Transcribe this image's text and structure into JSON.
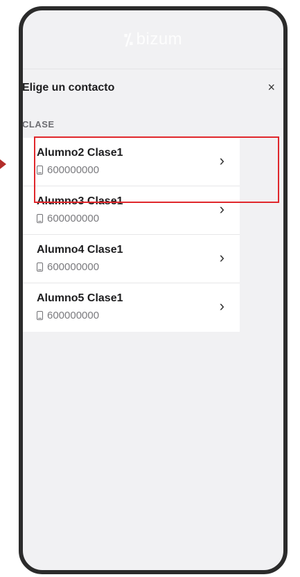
{
  "header": {
    "brand_mark": "⁒",
    "brand_name": "bizum"
  },
  "sheet": {
    "title": "Elige un contacto",
    "close_symbol": "×"
  },
  "section": {
    "label": "CLASE"
  },
  "contacts": [
    {
      "name": "Alumno2 Clase1",
      "phone": "600000000"
    },
    {
      "name": "Alumno3 Clase1",
      "phone": "600000000"
    },
    {
      "name": "Alumno4 Clase1",
      "phone": "600000000"
    },
    {
      "name": "Alumno5 Clase1",
      "phone": "600000000"
    }
  ],
  "chevron": "›",
  "colors": {
    "highlight": "#e0262b",
    "frame": "#2b2b2b",
    "background": "#f1f1f3"
  }
}
